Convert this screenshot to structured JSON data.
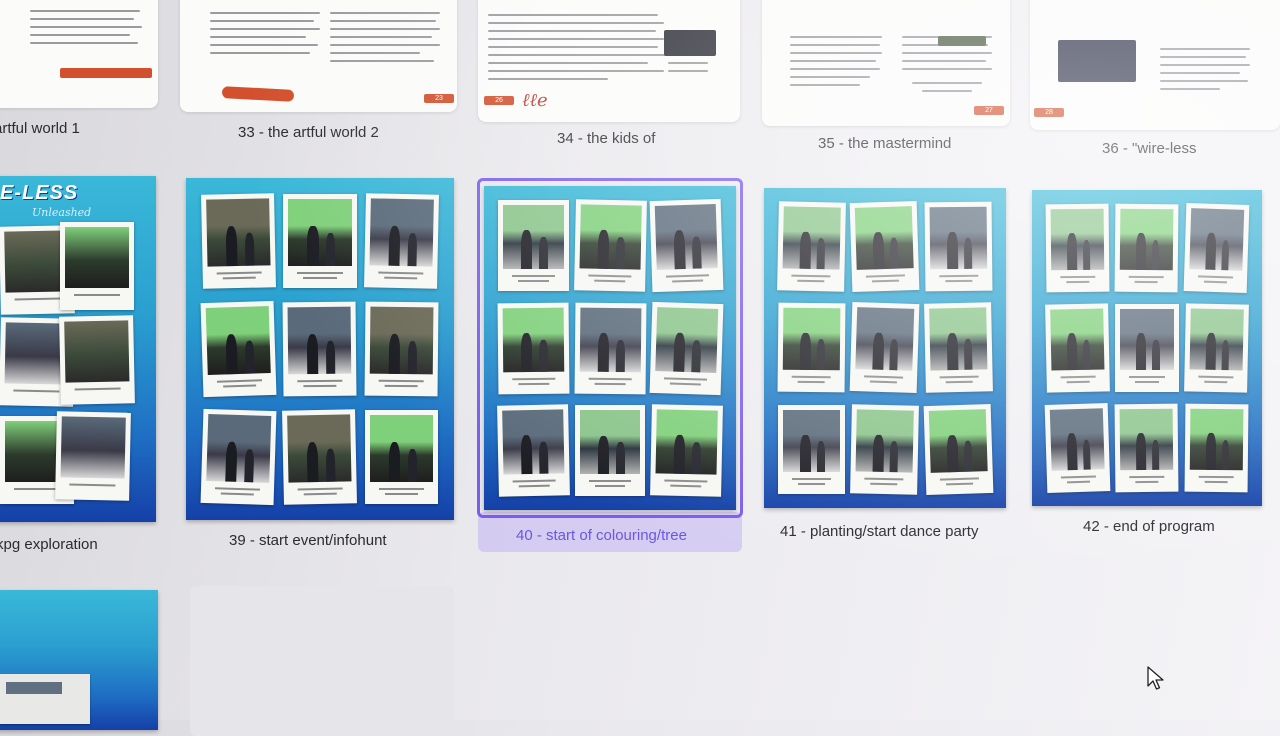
{
  "top_row": [
    {
      "label": "artful world 1",
      "page_number": ""
    },
    {
      "label": "33 - the artful world 2",
      "page_number": "23"
    },
    {
      "label": "34 - the kids of",
      "page_number": "26"
    },
    {
      "label": "35 - the mastermind",
      "page_number": "27"
    },
    {
      "label": "36 - \"wire-less",
      "page_number": "28"
    }
  ],
  "middle_row": [
    {
      "label": "kpg exploration",
      "banner": "E-LESS",
      "banner_sub": "Unleashed"
    },
    {
      "label": "39 - start event/infohunt"
    },
    {
      "label": "40 - start of colouring/tree",
      "selected": true
    },
    {
      "label": "41 - planting/start dance party"
    },
    {
      "label": "42 - end of program"
    }
  ],
  "colors": {
    "selection": "#7b5cf0",
    "page_gradient_top": "#3ab8d8",
    "page_gradient_bottom": "#1540a8",
    "page_number_tag": "#d2502e"
  },
  "icons": {
    "cursor": "mouse-pointer-icon"
  }
}
